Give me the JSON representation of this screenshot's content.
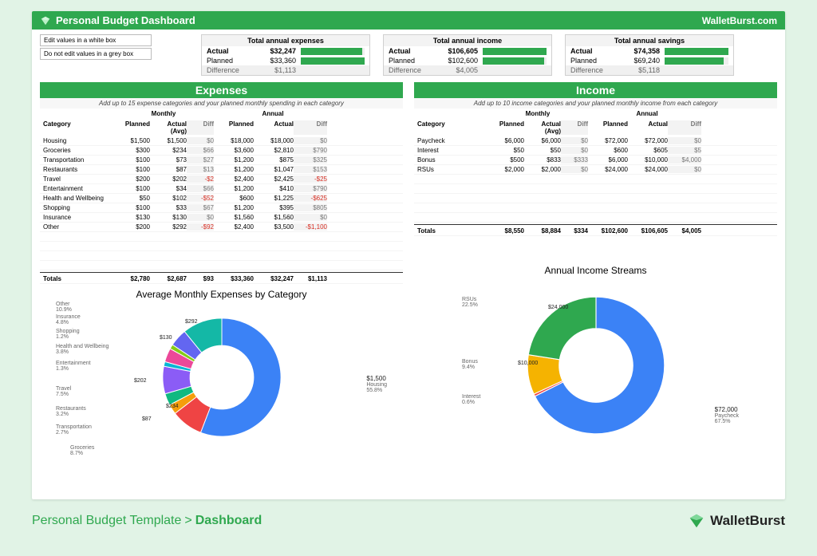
{
  "titlebar": {
    "title": "Personal Budget Dashboard",
    "site": "WalletBurst.com"
  },
  "notes": {
    "a": "Edit values in a white box",
    "b": "Do not edit values in a grey box"
  },
  "summary": {
    "expenses": {
      "title": "Total annual expenses",
      "actual_lbl": "Actual",
      "actual": "$32,247",
      "planned_lbl": "Planned",
      "planned": "$33,360",
      "diff_lbl": "Difference",
      "diff": "$1,113"
    },
    "income": {
      "title": "Total annual income",
      "actual_lbl": "Actual",
      "actual": "$106,605",
      "planned_lbl": "Planned",
      "planned": "$102,600",
      "diff_lbl": "Difference",
      "diff": "$4,005"
    },
    "savings": {
      "title": "Total annual savings",
      "actual_lbl": "Actual",
      "actual": "$74,358",
      "planned_lbl": "Planned",
      "planned": "$69,240",
      "diff_lbl": "Difference",
      "diff": "$5,118"
    }
  },
  "expenses": {
    "head": "Expenses",
    "sub": "Add up to 15 expense categories and your planned monthly spending in each category",
    "cols": {
      "cat": "Category",
      "monthly": "Monthly",
      "annual": "Annual",
      "planned": "Planned",
      "actual": "Actual (Avg)",
      "actual2": "Actual",
      "diff": "Diff"
    },
    "rows": [
      {
        "cat": "Housing",
        "mp": "$1,500",
        "ma": "$1,500",
        "md": "$0",
        "ap": "$18,000",
        "aa": "$18,000",
        "ad": "$0"
      },
      {
        "cat": "Groceries",
        "mp": "$300",
        "ma": "$234",
        "md": "$66",
        "ap": "$3,600",
        "aa": "$2,810",
        "ad": "$790"
      },
      {
        "cat": "Transportation",
        "mp": "$100",
        "ma": "$73",
        "md": "$27",
        "ap": "$1,200",
        "aa": "$875",
        "ad": "$325"
      },
      {
        "cat": "Restaurants",
        "mp": "$100",
        "ma": "$87",
        "md": "$13",
        "ap": "$1,200",
        "aa": "$1,047",
        "ad": "$153"
      },
      {
        "cat": "Travel",
        "mp": "$200",
        "ma": "$202",
        "md": "-$2",
        "mdneg": true,
        "ap": "$2,400",
        "aa": "$2,425",
        "ad": "-$25",
        "adneg": true
      },
      {
        "cat": "Entertainment",
        "mp": "$100",
        "ma": "$34",
        "md": "$66",
        "ap": "$1,200",
        "aa": "$410",
        "ad": "$790"
      },
      {
        "cat": "Health and Wellbeing",
        "mp": "$50",
        "ma": "$102",
        "md": "-$52",
        "mdneg": true,
        "ap": "$600",
        "aa": "$1,225",
        "ad": "-$625",
        "adneg": true
      },
      {
        "cat": "Shopping",
        "mp": "$100",
        "ma": "$33",
        "md": "$67",
        "ap": "$1,200",
        "aa": "$395",
        "ad": "$805"
      },
      {
        "cat": "Insurance",
        "mp": "$130",
        "ma": "$130",
        "md": "$0",
        "ap": "$1,560",
        "aa": "$1,560",
        "ad": "$0"
      },
      {
        "cat": "Other",
        "mp": "$200",
        "ma": "$292",
        "md": "-$92",
        "mdneg": true,
        "ap": "$2,400",
        "aa": "$3,500",
        "ad": "-$1,100",
        "adneg": true
      }
    ],
    "totals": {
      "cat": "Totals",
      "mp": "$2,780",
      "ma": "$2,687",
      "md": "$93",
      "ap": "$33,360",
      "aa": "$32,247",
      "ad": "$1,113"
    },
    "chart_title": "Average Monthly Expenses by Category"
  },
  "income": {
    "head": "Income",
    "sub": "Add up to 10 income categories and your planned monthly income from each category",
    "rows": [
      {
        "cat": "Paycheck",
        "mp": "$6,000",
        "ma": "$6,000",
        "md": "$0",
        "ap": "$72,000",
        "aa": "$72,000",
        "ad": "$0"
      },
      {
        "cat": "Interest",
        "mp": "$50",
        "ma": "$50",
        "md": "$0",
        "ap": "$600",
        "aa": "$605",
        "ad": "$5"
      },
      {
        "cat": "Bonus",
        "mp": "$500",
        "ma": "$833",
        "md": "$333",
        "ap": "$6,000",
        "aa": "$10,000",
        "ad": "$4,000"
      },
      {
        "cat": "RSUs",
        "mp": "$2,000",
        "ma": "$2,000",
        "md": "$0",
        "ap": "$24,000",
        "aa": "$24,000",
        "ad": "$0"
      }
    ],
    "totals": {
      "cat": "Totals",
      "mp": "$8,550",
      "ma": "$8,884",
      "md": "$334",
      "ap": "$102,600",
      "aa": "$106,605",
      "ad": "$4,005"
    },
    "chart_title": "Annual Income Streams"
  },
  "footer": {
    "bc1": "Personal Budget Template",
    "bc2": "Dashboard",
    "brand": "WalletBurst"
  },
  "chart_data": [
    {
      "type": "pie",
      "title": "Average Monthly Expenses by Category",
      "series": [
        {
          "name": "Actual (Avg) $",
          "values": [
            1500,
            234,
            73,
            87,
            202,
            34,
            102,
            33,
            130,
            292
          ]
        }
      ],
      "categories": [
        "Housing",
        "Groceries",
        "Transportation",
        "Restaurants",
        "Travel",
        "Entertainment",
        "Health and Wellbeing",
        "Shopping",
        "Insurance",
        "Other"
      ],
      "percent_labels": [
        "55.8%",
        "8.7%",
        "2.7%",
        "3.2%",
        "7.5%",
        "1.3%",
        "3.8%",
        "1.2%",
        "4.8%",
        "10.9%"
      ],
      "value_labels": [
        "$1,500",
        "$234",
        "",
        "$87",
        "$202",
        "",
        "",
        "",
        "$130",
        "$292"
      ]
    },
    {
      "type": "pie",
      "title": "Annual Income Streams",
      "series": [
        {
          "name": "Annual Actual $",
          "values": [
            72000,
            605,
            10000,
            24000
          ]
        }
      ],
      "categories": [
        "Paycheck",
        "Interest",
        "Bonus",
        "RSUs"
      ],
      "percent_labels": [
        "67.5%",
        "0.6%",
        "9.4%",
        "22.5%"
      ],
      "value_labels": [
        "$72,000",
        "",
        "$10,000",
        "$24,000"
      ]
    }
  ]
}
